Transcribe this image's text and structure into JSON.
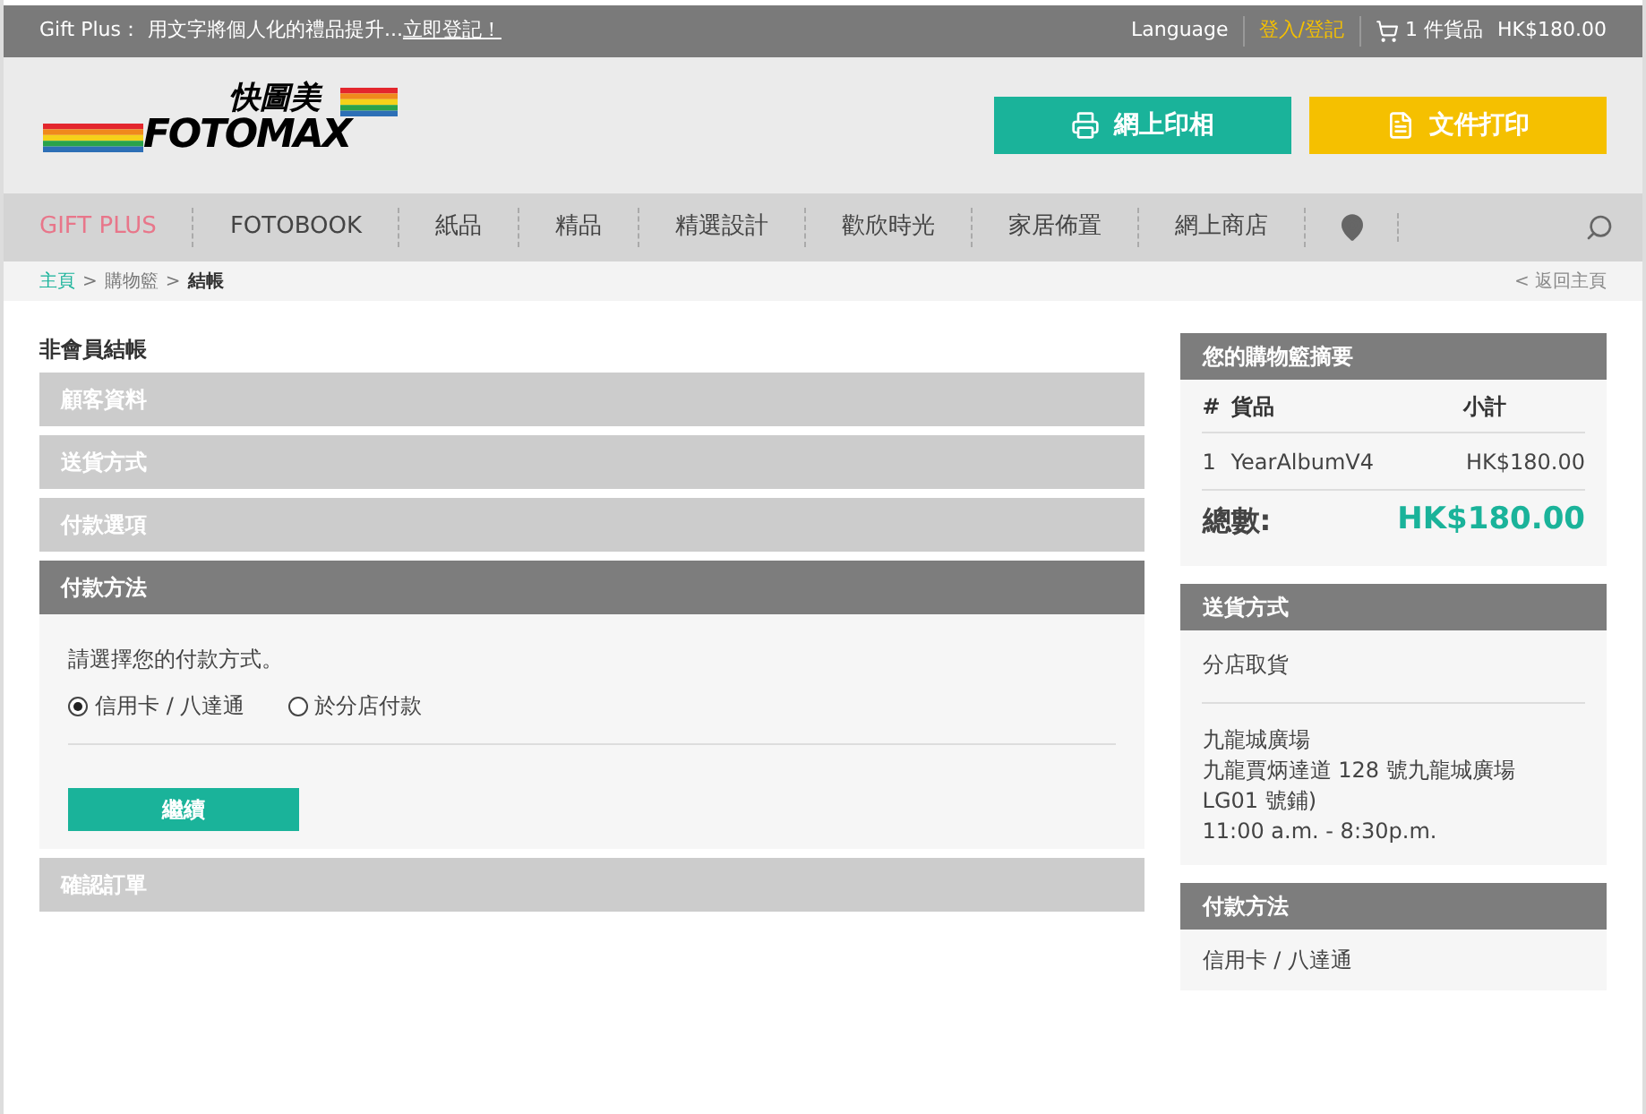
{
  "top_bar": {
    "promo_label": "Gift Plus：",
    "promo_text": "用文字將個人化的禮品提升...",
    "promo_link": "立即登記！",
    "language": "Language",
    "login": "登入/登記",
    "cart": "1 件貨品",
    "cart_total": "HK$180.00"
  },
  "logo": {
    "chinese": "快圖美",
    "english": "FOTOMAX"
  },
  "header_buttons": [
    {
      "label": "網上印相",
      "color": "#1ab39a"
    },
    {
      "label": "文件打印",
      "color": "#f5c000"
    }
  ],
  "nav": [
    {
      "label": "GIFT PLUS",
      "selected": true
    },
    {
      "label": "FOTOBOOK",
      "selected": false
    },
    {
      "label": "紙品",
      "selected": false
    },
    {
      "label": "精品",
      "selected": false
    },
    {
      "label": "精選設計",
      "selected": false
    },
    {
      "label": "歡欣時光",
      "selected": false
    },
    {
      "label": "家居佈置",
      "selected": false
    },
    {
      "label": "網上商店",
      "selected": false
    }
  ],
  "breadcrumb": [
    {
      "label": "主頁",
      "kind": "link"
    },
    {
      "label": "購物籃",
      "kind": "plain"
    },
    {
      "label": "結帳",
      "kind": "current"
    }
  ],
  "breadcrumb_separator": ">",
  "back_link": "< 返回主頁",
  "checkout": {
    "title": "非會員結帳",
    "steps": [
      {
        "label": "顧客資料",
        "expanded": false
      },
      {
        "label": "送貨方式",
        "expanded": false
      },
      {
        "label": "付款選項",
        "expanded": false
      },
      {
        "label": "付款方法",
        "expanded": true
      },
      {
        "label": "確認訂單",
        "expanded": false
      }
    ],
    "prompt": "請選擇您的付款方式。",
    "options": [
      {
        "label": "信用卡 / 八達通",
        "selected": true
      },
      {
        "label": "於分店付款",
        "selected": false
      }
    ],
    "continue_button": "繼續"
  },
  "summary": {
    "title": "您的購物籃摘要",
    "columns": [
      "#",
      "貨品",
      "小計"
    ],
    "rows": [
      [
        "1",
        "YearAlbumV4",
        "HK$180.00"
      ]
    ],
    "total_label": "總數:",
    "total": "HK$180.00"
  },
  "delivery": {
    "title": "送貨方式",
    "method": "分店取貨",
    "address": [
      "九龍城廣場",
      "九龍賈炳達道 128 號九龍城廣場",
      "LG01 號鋪)",
      "11:00 a.m. - 8:30p.m."
    ]
  },
  "payment": {
    "title": "付款方法",
    "method": "信用卡 / 八達通"
  }
}
